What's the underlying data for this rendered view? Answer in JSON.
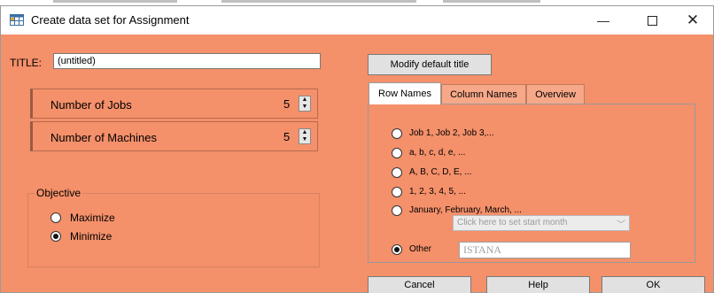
{
  "window": {
    "title": "Create data set for Assignment",
    "minimize_glyph": "—",
    "close_glyph": "✕",
    "app_icon": "table-icon"
  },
  "title_field": {
    "label": "TITLE:",
    "value": "(untitled)"
  },
  "jobs": {
    "label": "Number of Jobs",
    "value": "5"
  },
  "machines": {
    "label": "Number of Machines",
    "value": "5"
  },
  "spinner_glyphs": {
    "up": "▲",
    "down": "▼"
  },
  "objective": {
    "label": "Objective",
    "options": [
      {
        "label": "Maximize",
        "checked": false
      },
      {
        "label": "Minimize",
        "checked": true
      }
    ]
  },
  "modify_button": "Modify default title",
  "tabs": [
    {
      "label": "Row Names",
      "active": true
    },
    {
      "label": "Column Names",
      "active": false
    },
    {
      "label": "Overview",
      "active": false
    }
  ],
  "row_name_options": [
    {
      "label": "Job 1, Job 2, Job 3,...",
      "checked": false
    },
    {
      "label": "a, b, c, d, e, ...",
      "checked": false
    },
    {
      "label": "A, B, C, D, E, ...",
      "checked": false
    },
    {
      "label": "1, 2, 3, 4, 5, ...",
      "checked": false
    },
    {
      "label": "January, February, March, ...",
      "checked": false
    },
    {
      "label": "Other",
      "checked": true
    }
  ],
  "start_month_select": {
    "placeholder": "Click here to set start month",
    "chevron": "﹀"
  },
  "other_value": "ISTANA",
  "buttons": {
    "cancel": "Cancel",
    "help": "Help",
    "ok": "OK"
  },
  "colors": {
    "window_background": "#f4906a",
    "titlebar_background": "#ffffff",
    "button_face": "#e1e1e1"
  }
}
